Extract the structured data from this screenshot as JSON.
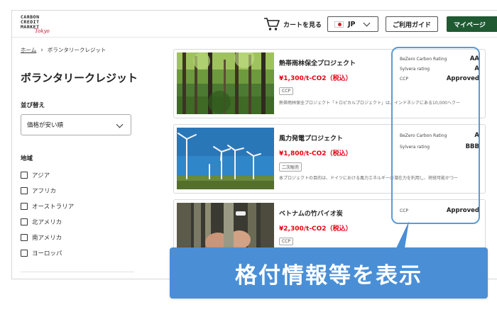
{
  "header": {
    "logo_lines": [
      "CARBON",
      "CREDIT",
      "MARKET"
    ],
    "logo_script": "Tokyo",
    "cart_label": "カートを見る",
    "language": "JP",
    "guide_label": "ご利用ガイド",
    "mypage_label": "マイページ"
  },
  "breadcrumb": {
    "home": "ホーム",
    "current": "ボランタリークレジット"
  },
  "page_title": "ボランタリークレジット",
  "sort": {
    "label": "並び替え",
    "selected": "価格が安い順"
  },
  "region": {
    "label": "地域",
    "options": [
      "アジア",
      "アフリカ",
      "オーストラリア",
      "北アメリカ",
      "南アメリカ",
      "ヨーロッパ"
    ]
  },
  "projects": [
    {
      "name": "熱帯雨林保全プロジェクト",
      "price": "¥1,300/t-CO2（税込）",
      "tag": "CCP",
      "description": "熱帯雨林保全プロジェクト「トロピカルプロジェクト」は、インドネシアにある10,000ヘクー",
      "image": "forest",
      "ratings": [
        {
          "label": "BeZero Carbon Rating",
          "value": "AA"
        },
        {
          "label": "Sylvera rating",
          "value": "A"
        },
        {
          "label": "CCP",
          "value": "Approved"
        }
      ]
    },
    {
      "name": "風力発電プロジェクト",
      "price": "¥1,800/t-CO2（税込）",
      "tag": "二次販売",
      "description": "本プロジェクトの目的は、ドイツにおける風力エネルギーの潜在力を利用し、将続可能かつー",
      "image": "wind-turbines",
      "ratings": [
        {
          "label": "BeZero Carbon Rating",
          "value": "A"
        },
        {
          "label": "Sylvera rating",
          "value": "BBB"
        }
      ]
    },
    {
      "name": "ベトナムの竹バイオ炭",
      "price": "¥2,300/t-CO2（税込）",
      "tag": "CCP",
      "description": "",
      "image": "bamboo",
      "ratings": [
        {
          "label": "CCP",
          "value": "Approved"
        }
      ]
    }
  ],
  "callout": "格付情報等を表示",
  "colors": {
    "brand_green": "#1f5a32",
    "price_red": "#e60012",
    "highlight_blue": "#5b9bd5",
    "callout_blue": "#4a8fd6"
  }
}
